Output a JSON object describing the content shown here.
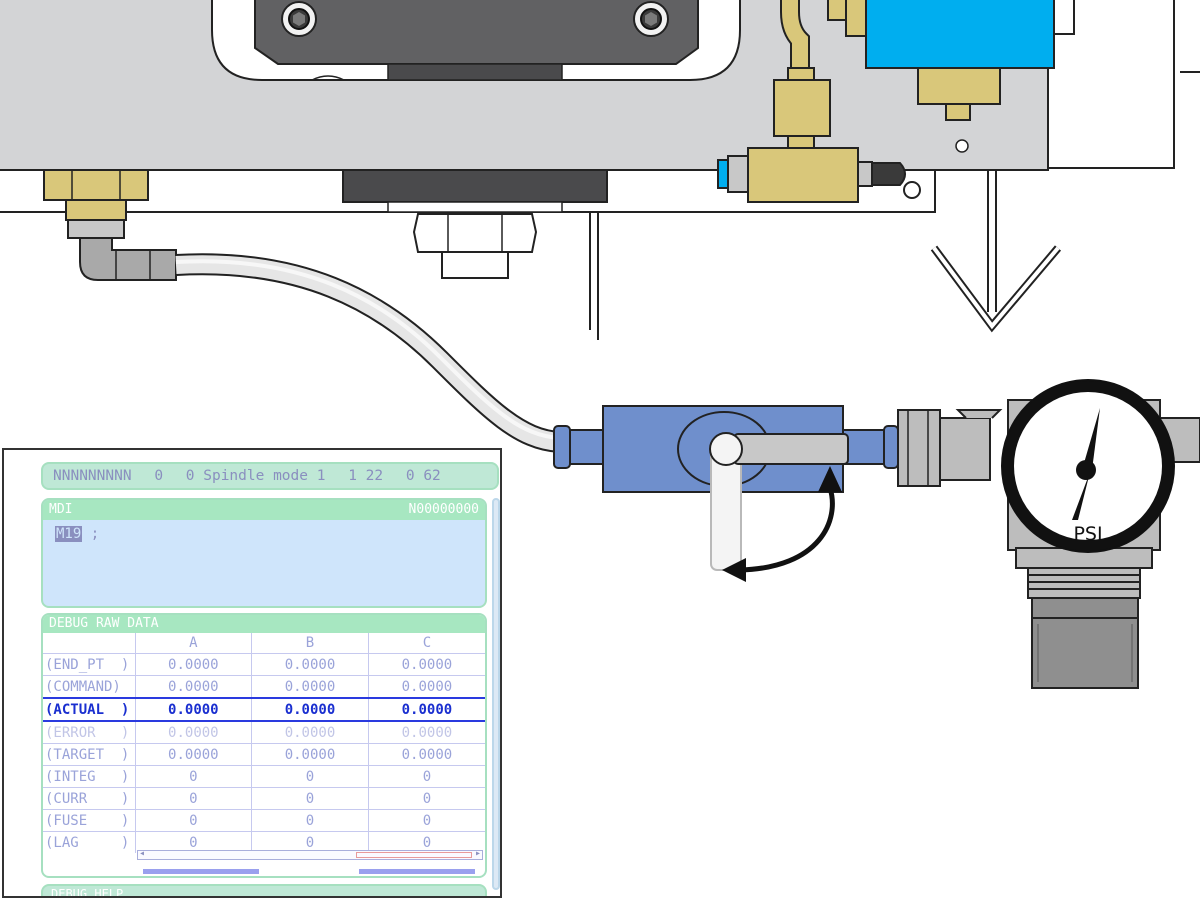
{
  "gauge": {
    "unit_label": "PSI"
  },
  "screen": {
    "status_bar": [
      "NNNNNNNNN",
      "0",
      "0 Spindle mode 1",
      "1 22",
      "0 62"
    ],
    "mdi": {
      "title": "MDI",
      "program_no": "N00000000",
      "command_code": "M19",
      "command_suffix": " ;"
    },
    "debug": {
      "title": "DEBUG RAW DATA",
      "columns": [
        "",
        "A",
        "B",
        "C"
      ],
      "rows": [
        {
          "label": "(END_PT  )",
          "values": [
            "0.0000",
            "0.0000",
            "0.0000"
          ],
          "state": "normal"
        },
        {
          "label": "(COMMAND)",
          "values": [
            "0.0000",
            "0.0000",
            "0.0000"
          ],
          "state": "normal"
        },
        {
          "label": "(ACTUAL  )",
          "values": [
            "0.0000",
            "0.0000",
            "0.0000"
          ],
          "state": "active"
        },
        {
          "label": "(ERROR   )",
          "values": [
            "0.0000",
            "0.0000",
            "0.0000"
          ],
          "state": "faded"
        },
        {
          "label": "(TARGET  )",
          "values": [
            "0.0000",
            "0.0000",
            "0.0000"
          ],
          "state": "normal"
        },
        {
          "label": "(INTEG   )",
          "values": [
            "0",
            "0",
            "0"
          ],
          "state": "normal"
        },
        {
          "label": "(CURR    )",
          "values": [
            "0",
            "0",
            "0"
          ],
          "state": "normal"
        },
        {
          "label": "(FUSE    )",
          "values": [
            "0",
            "0",
            "0"
          ],
          "state": "normal"
        },
        {
          "label": "(LAG     )",
          "values": [
            "0",
            "0",
            "0"
          ],
          "state": "normal"
        }
      ]
    },
    "bottom_tab": "DEBUG HELP"
  },
  "colors": {
    "machine_gray": "#d3d4d6",
    "brass": "#d9c77a",
    "valve_blue": "#6f8fcc",
    "solenoid_blue": "#00aeef",
    "screen_green": "#a7e7c1",
    "screen_blue": "#cfe5fb",
    "text_lavender": "#9aa3d9"
  },
  "icons": [
    "socket-screw-icon",
    "arrow-down-icon",
    "rotate-arrow-icon",
    "gauge-needle-icon"
  ]
}
